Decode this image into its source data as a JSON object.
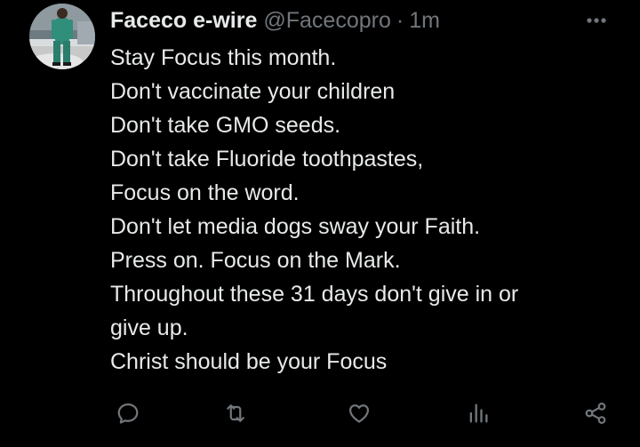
{
  "post": {
    "author": {
      "display_name": "Faceco e-wire",
      "handle": "@Facecopro",
      "separator": "·",
      "time": "1m"
    },
    "text_lines": [
      "Stay Focus this month.",
      "Don't vaccinate your children",
      "Don't take GMO seeds.",
      "Don't take Fluoride toothpastes,",
      "Focus on the word.",
      "Don't let media dogs sway your Faith.",
      "Press on. Focus on the Mark.",
      "Throughout these 31 days don't give in or",
      "give up.",
      "Christ should be your Focus"
    ]
  },
  "icons": {
    "avatar": "avatar-photo",
    "more": "more-dots-icon",
    "reply": "reply-icon",
    "repost": "repost-icon",
    "like": "like-icon",
    "views": "views-icon",
    "share": "share-icon"
  },
  "colors": {
    "background": "#000000",
    "primary_text": "#e7e9ea",
    "secondary_text": "#71767b"
  }
}
